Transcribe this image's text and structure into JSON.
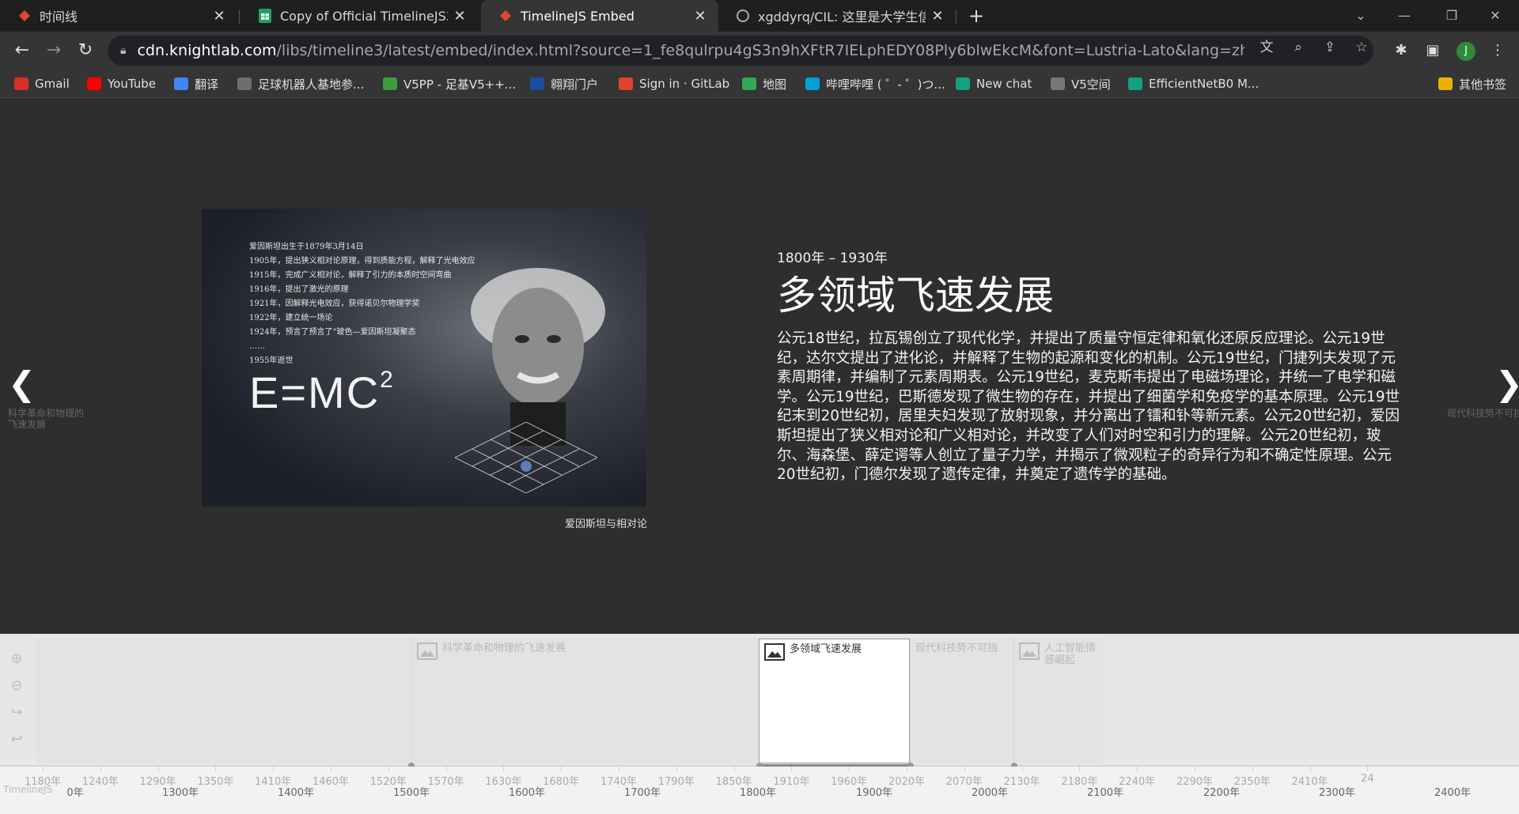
{
  "browser": {
    "tabs": [
      {
        "title": "时间线",
        "icon": "timelinejs-icon",
        "active": false
      },
      {
        "title": "Copy of Official TimelineJS3 Te",
        "icon": "sheets-icon",
        "active": false
      },
      {
        "title": "TimelineJS Embed",
        "icon": "timelinejs-icon",
        "active": true
      },
      {
        "title": "xgddyrq/CIL: 这里是大学生信息",
        "icon": "github-icon",
        "active": false
      }
    ],
    "url_host": "cdn.knightlab.com",
    "url_rest": "/libs/timeline3/latest/embed/index.html?source=1_fe8qulrpu4gS3n9hXFtR7IELphEDY08Ply6blwEkcM&font=Lustria-Lato&lang=zh-cn&initial_zoom...",
    "profile_initial": "J",
    "bookmarks": [
      {
        "label": "Gmail",
        "color": "#d93025"
      },
      {
        "label": "YouTube",
        "color": "#ff0000"
      },
      {
        "label": "翻译",
        "color": "#4285f4"
      },
      {
        "label": "足球机器人基地参...",
        "color": "#6e6e6e"
      },
      {
        "label": "V5PP - 足基V5++...",
        "color": "#3c9d3c"
      },
      {
        "label": "翱翔门户",
        "color": "#1a4ea0"
      },
      {
        "label": "Sign in · GitLab",
        "color": "#e24329"
      },
      {
        "label": "地图",
        "color": "#34a853"
      },
      {
        "label": "哔哩哔哩 ( ゜- ゜)つ...",
        "color": "#00a1d6"
      },
      {
        "label": "New chat",
        "color": "#10a37f"
      },
      {
        "label": "V5空间",
        "color": "#777777"
      },
      {
        "label": "EfficientNetB0 M...",
        "color": "#10a37f"
      }
    ],
    "other_bookmarks": "其他书签"
  },
  "slide": {
    "media_notes": [
      "爱因斯坦出生于1879年3月14日",
      "1905年，提出狭义相对论原理，得到质能方程，解释了光电效应",
      "1915年，完成广义相对论，解释了引力的本质时空间弯曲",
      "1916年，提出了激光的原理",
      "1921年，因解释光电效应，获得诺贝尔物理学奖",
      "1922年，建立统一场论",
      "1924年，预言了预言了“玻色—爱因斯坦凝聚态",
      "……",
      "1955年逝世"
    ],
    "media_formula": "E=MC",
    "media_formula_exp": "2",
    "caption": "爱因斯坦与相对论",
    "dates": "1800年 – 1930年",
    "headline": "多领域飞速发展",
    "text": "公元18世纪，拉瓦锡创立了现代化学，并提出了质量守恒定律和氧化还原反应理论。公元19世纪，达尔文提出了进化论，并解释了生物的起源和变化的机制。公元19世纪，门捷列夫发现了元素周期律，并编制了元素周期表。公元19世纪，麦克斯韦提出了电磁场理论，并统一了电学和磁学。公元19世纪，巴斯德发现了微生物的存在，并提出了细菌学和免疫学的基本原理。公元19世纪末到20世纪初，居里夫妇发现了放射现象，并分离出了镭和钋等新元素。公元20世纪初，爱因斯坦提出了狭义相对论和广义相对论，并改变了人们对时空和引力的理解。公元20世纪初，玻尔、海森堡、薛定谔等人创立了量子力学，并揭示了微观粒子的奇异行为和不确定性原理。公元20世纪初，门德尔发现了遗传定律，并奠定了遗传学的基础。",
    "prev_label": "科学革命和物理的飞速发展",
    "next_label": "现代科技势不可挡"
  },
  "timeline_nav": {
    "markers": [
      {
        "title": "科学革命和物理的飞速发展",
        "active": false
      },
      {
        "title": "多领域飞速发展",
        "active": true
      },
      {
        "title": "现代科技势不可挡",
        "active": false
      },
      {
        "title": "人工智能情感崛起",
        "active": false
      }
    ],
    "minor_ticks": [
      "1180年",
      "1240年",
      "1290年",
      "1350年",
      "1410年",
      "1460年",
      "1520年",
      "1570年",
      "1630年",
      "1680年",
      "1740年",
      "1790年",
      "1850年",
      "1910年",
      "1960年",
      "2020年",
      "2070年",
      "2130年",
      "2180年",
      "2240年",
      "2290年",
      "2350年",
      "2410年",
      "24"
    ],
    "major_ticks": [
      "0年",
      "1300年",
      "1400年",
      "1500年",
      "1600年",
      "1700年",
      "1800年",
      "1900年",
      "2000年",
      "2100年",
      "2200年",
      "2300年",
      "2400年"
    ],
    "brand": "TimelineJS"
  }
}
